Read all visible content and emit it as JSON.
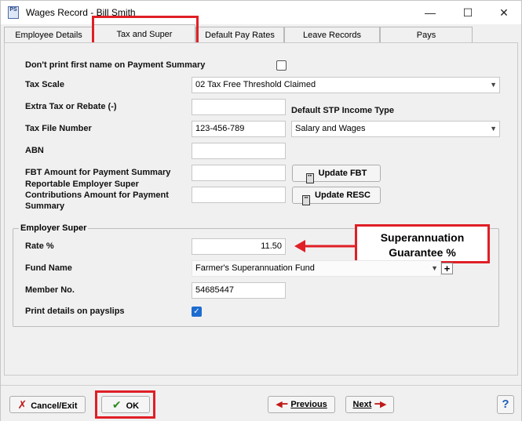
{
  "window": {
    "app_icon": "PS",
    "title": "Wages Record - Bill Smith",
    "minimize": "—",
    "maximize": "☐",
    "close": "✕"
  },
  "tabs": [
    {
      "label": "Employee Details"
    },
    {
      "label": "Tax and Super"
    },
    {
      "label": "Default Pay Rates"
    },
    {
      "label": "Leave Records"
    },
    {
      "label": "Pays"
    }
  ],
  "form": {
    "dont_print_first_name": {
      "label": "Don't print first name on Payment Summary",
      "checked": false
    },
    "tax_scale": {
      "label": "Tax Scale",
      "value": "02 Tax Free Threshold Claimed"
    },
    "extra_tax": {
      "label": "Extra Tax or Rebate (-)",
      "value": ""
    },
    "default_stp": {
      "label": "Default STP Income Type",
      "value": "Salary and Wages"
    },
    "tfn": {
      "label": "Tax File Number",
      "value": "123-456-789"
    },
    "abn": {
      "label": "ABN",
      "value": ""
    },
    "fbt": {
      "label": "FBT Amount for Payment Summary",
      "value": "",
      "button": "Update FBT"
    },
    "resc": {
      "label": "Reportable Employer Super Contributions Amount for Payment Summary",
      "value": "",
      "button": "Update RESC"
    }
  },
  "employer_super": {
    "group_title": "Employer Super",
    "rate": {
      "label": "Rate %",
      "value": "11.50"
    },
    "fund_name": {
      "label": "Fund Name",
      "value": "Farmer's Superannuation Fund",
      "add": "+"
    },
    "member_no": {
      "label": "Member No.",
      "value": "54685447"
    },
    "print_details": {
      "label": "Print details on payslips",
      "checked": true
    }
  },
  "callout": {
    "text": "Superannuation Guarantee %",
    "color": "#e01f26"
  },
  "footer": {
    "cancel": "Cancel/Exit",
    "ok": "OK",
    "previous": "Previous",
    "next": "Next",
    "help": "?"
  }
}
